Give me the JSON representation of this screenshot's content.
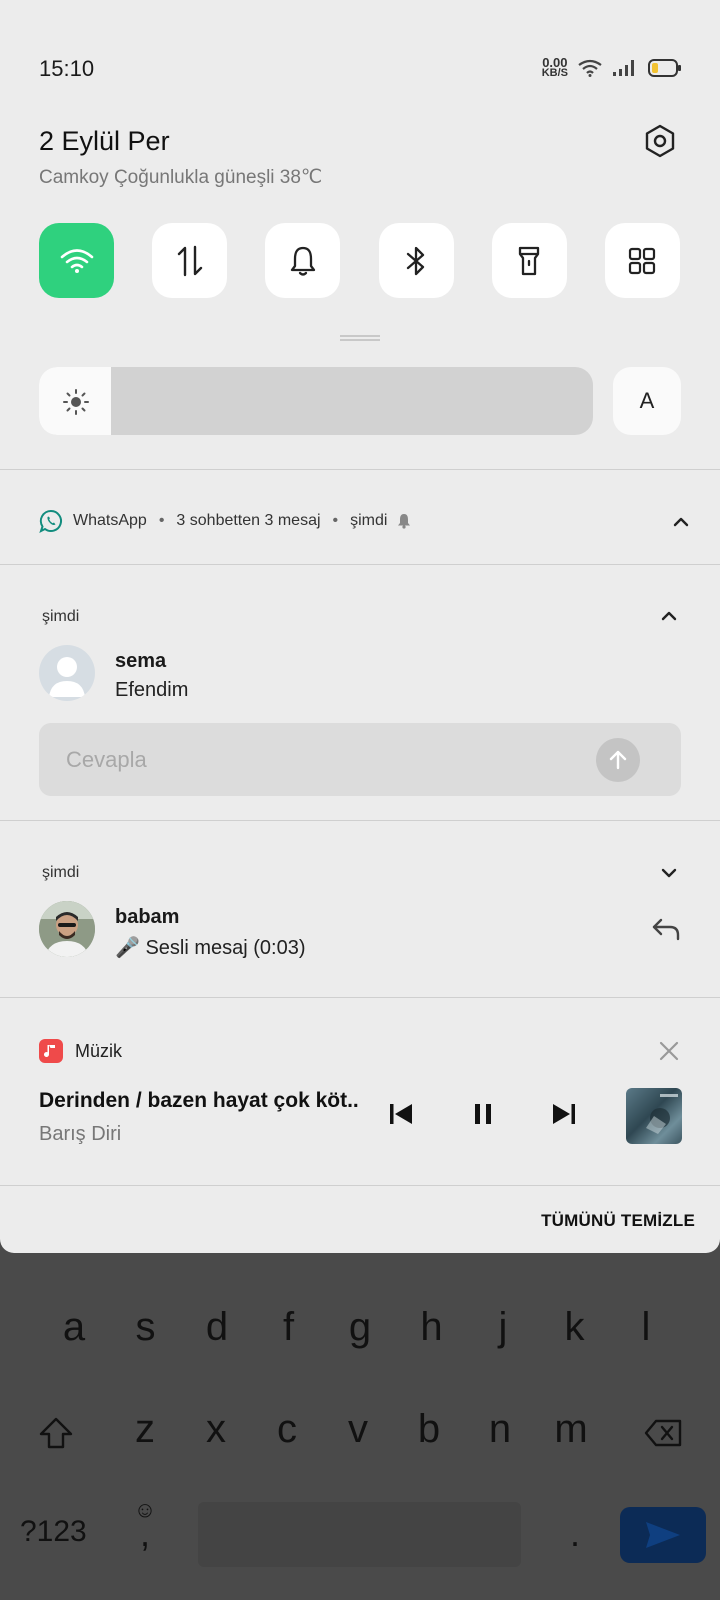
{
  "status_bar": {
    "time": "15:10",
    "net_speed_value": "0.00",
    "net_speed_unit": "KB/S",
    "battery_level": 0.2
  },
  "header": {
    "date": "2 Eylül Per",
    "weather": "Camkoy Çoğunlukla güneşli 38℃"
  },
  "quick_settings": [
    {
      "name": "wifi",
      "active": true
    },
    {
      "name": "mobile-data",
      "active": false
    },
    {
      "name": "sound",
      "active": false
    },
    {
      "name": "bluetooth",
      "active": false
    },
    {
      "name": "flashlight",
      "active": false
    },
    {
      "name": "more-toggles",
      "active": false
    }
  ],
  "brightness": {
    "level": 0.13,
    "auto_label": "A"
  },
  "whatsapp": {
    "app_name": "WhatsApp",
    "summary": "3 sohbetten 3 mesaj",
    "time": "şimdi",
    "dot": "•",
    "messages": [
      {
        "time": "şimdi",
        "sender": "sema",
        "text": "Efendim"
      },
      {
        "time": "şimdi",
        "sender": "babam",
        "text": "🎤 Sesli mesaj (0:03)"
      }
    ],
    "reply_placeholder": "Cevapla"
  },
  "music": {
    "app_name": "Müzik",
    "title": "Derinden / bazen hayat çok köt..",
    "artist": "Barış Diri"
  },
  "clear_all": "TÜMÜNÜ TEMİZLE",
  "keyboard": {
    "row2": [
      "a",
      "s",
      "d",
      "f",
      "g",
      "h",
      "j",
      "k",
      "l"
    ],
    "row3": [
      "z",
      "x",
      "c",
      "v",
      "b",
      "n",
      "m"
    ],
    "symbols": "?123",
    "comma": ",",
    "period": ".",
    "emoji": "☺"
  },
  "colors": {
    "accent_green": "#2fd17e",
    "shade_bg": "#ececec",
    "keyboard_bg": "#4a4a4a",
    "send_blue": "#0c2b56",
    "music_red": "#ef4a4a",
    "whatsapp_green": "#128c7e"
  }
}
